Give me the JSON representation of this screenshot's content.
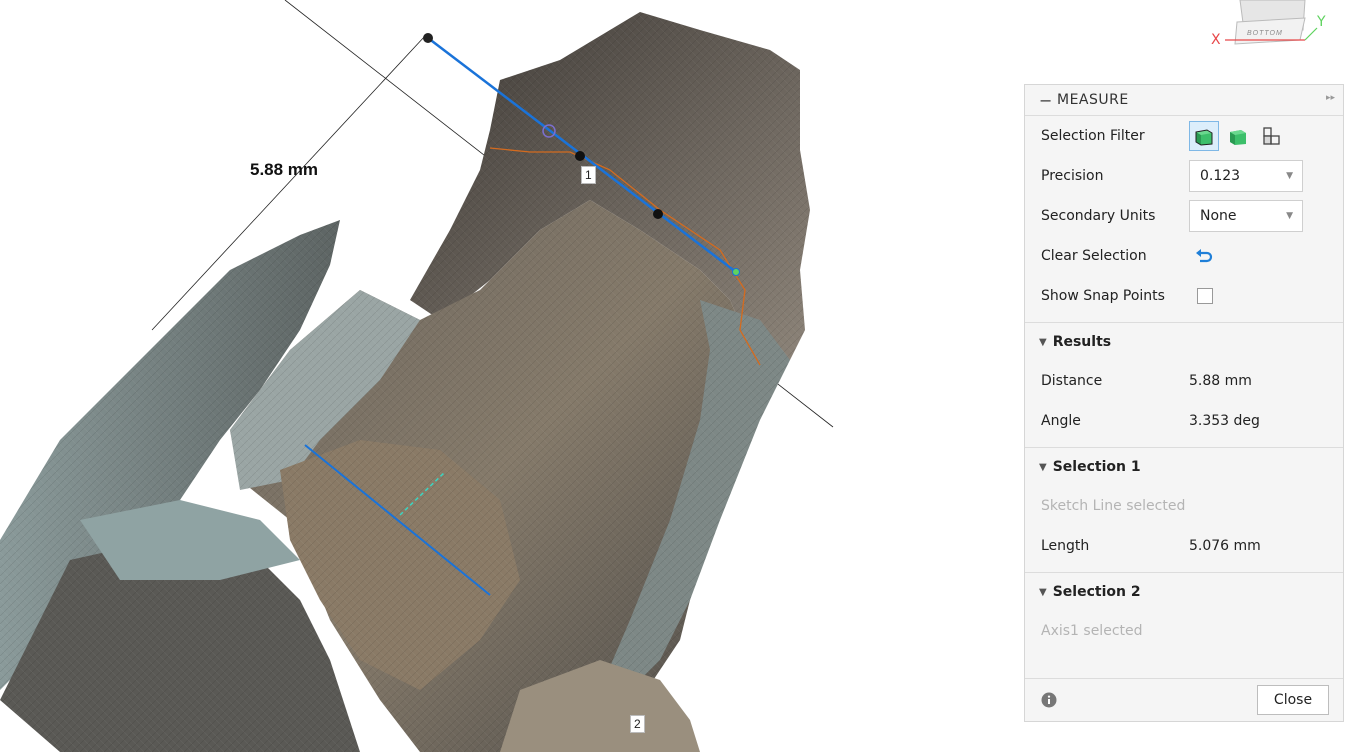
{
  "viewport": {
    "dimension_label": "5.88 mm",
    "point_label_1": "1",
    "point_label_2": "2"
  },
  "viewcube": {
    "face": "BOTTOM",
    "axis_x": "X",
    "axis_y": "Y"
  },
  "panel": {
    "title": "MEASURE",
    "selection_filter_label": "Selection Filter",
    "precision_label": "Precision",
    "precision_value": "0.123",
    "secondary_units_label": "Secondary Units",
    "secondary_units_value": "None",
    "clear_selection_label": "Clear Selection",
    "show_snap_points_label": "Show Snap Points",
    "results": {
      "title": "Results",
      "distance_label": "Distance",
      "distance_value": "5.88 mm",
      "angle_label": "Angle",
      "angle_value": "3.353 deg"
    },
    "selection1": {
      "title": "Selection 1",
      "description": "Sketch Line selected",
      "length_label": "Length",
      "length_value": "5.076 mm"
    },
    "selection2": {
      "title": "Selection 2",
      "description": "Axis1 selected"
    },
    "close_label": "Close"
  },
  "colors": {
    "measure_line": "#1a73d9",
    "axis_x": "#e8484a",
    "axis_y": "#5fd35f",
    "filter_green": "#3cbf6a",
    "accent_blue": "#1f7fd8"
  }
}
